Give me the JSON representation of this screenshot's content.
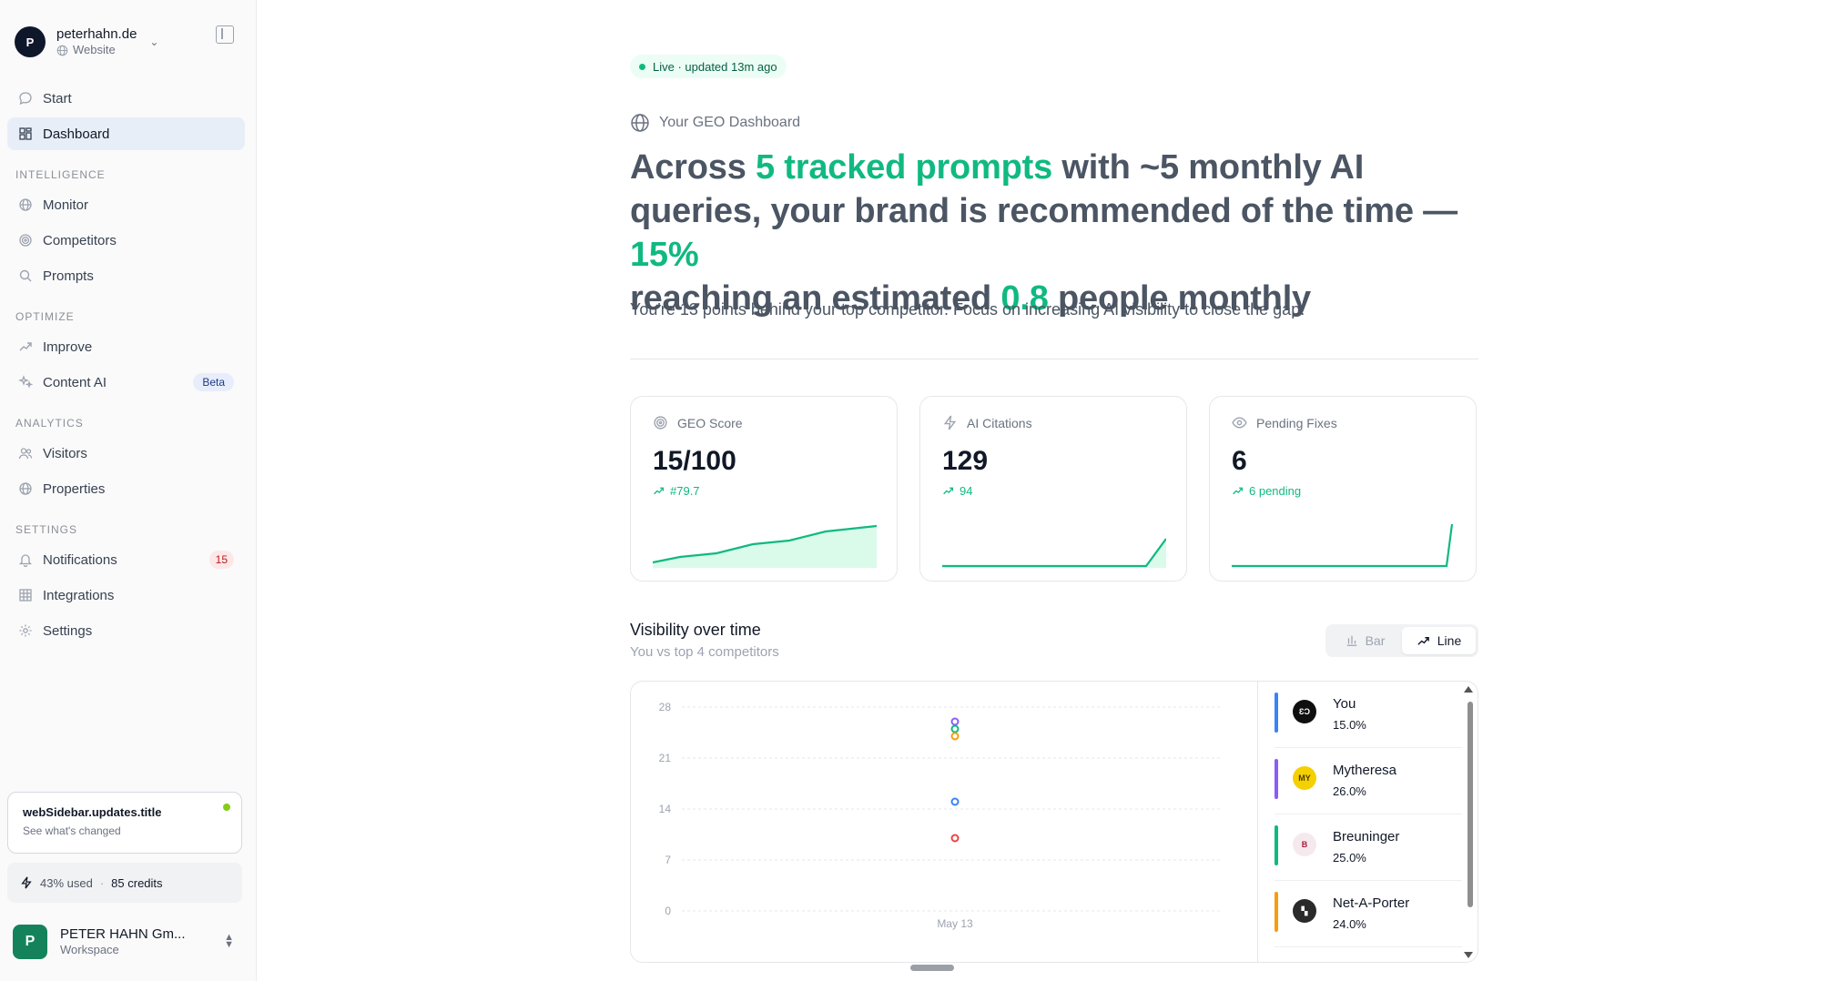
{
  "workspace": {
    "name": "peterhahn.de",
    "type": "Website",
    "avatar_letter": "P"
  },
  "nav": {
    "start": "Start",
    "dashboard": "Dashboard",
    "sections": {
      "intelligence": "INTELLIGENCE",
      "optimize": "OPTIMIZE",
      "analytics": "ANALYTICS",
      "settings": "SETTINGS"
    },
    "monitor": "Monitor",
    "competitors": "Competitors",
    "prompts": "Prompts",
    "improve": "Improve",
    "content_ai": "Content AI",
    "content_ai_badge": "Beta",
    "visitors": "Visitors",
    "properties": "Properties",
    "notifications": "Notifications",
    "notifications_count": "15",
    "integrations": "Integrations",
    "settings": "Settings"
  },
  "updates": {
    "title": "webSidebar.updates.title",
    "subtitle": "See what's changed"
  },
  "credits": {
    "used": "43% used",
    "remaining": "85 credits"
  },
  "org": {
    "name": "PETER HAHN Gm...",
    "sub": "Workspace",
    "avatar_letter": "P"
  },
  "status": {
    "live": "Live · updated 13m ago"
  },
  "dashboard_label": "Your GEO Dashboard",
  "headline": {
    "p1": "Across ",
    "h1": "5 tracked prompts",
    "p2": " with ~5 monthly AI queries, your brand is recommended of the time — ",
    "h2": "15%",
    "p3": " reaching an estimated ",
    "h3": "0.8",
    "p4": " people monthly"
  },
  "subline": "You're 13 points behind your top competitor. Focus on increasing AI visibility to close the gap.",
  "cards": [
    {
      "label": "GEO Score",
      "value": "15/100",
      "trend": "#79.7",
      "icon": "target-icon"
    },
    {
      "label": "AI Citations",
      "value": "129",
      "trend": "94",
      "icon": "lightning-icon"
    },
    {
      "label": "Pending Fixes",
      "value": "6",
      "trend": "6 pending",
      "icon": "eye-icon"
    }
  ],
  "visibility": {
    "title": "Visibility over time",
    "subtitle": "You vs top 4 competitors",
    "toggle_bar": "Bar",
    "toggle_line": "Line",
    "active": "Line"
  },
  "colors": {
    "accent": "#10b981",
    "you": "#3b82f6",
    "mytheresa": "#8b5cf6",
    "breuninger": "#10b981",
    "netaporter": "#f59e0b",
    "extra": "#ef4444"
  },
  "chart_data": {
    "type": "line",
    "x": [
      "May 13"
    ],
    "yticks": [
      0,
      7,
      14,
      21,
      28
    ],
    "ylim": [
      0,
      30
    ],
    "series": [
      {
        "name": "You",
        "values": [
          15
        ]
      },
      {
        "name": "Mytheresa",
        "values": [
          26
        ]
      },
      {
        "name": "Breuninger",
        "values": [
          25
        ]
      },
      {
        "name": "Net-A-Porter",
        "values": [
          24
        ]
      },
      {
        "values": [
          10
        ]
      }
    ]
  },
  "legend": [
    {
      "name": "You",
      "pct": "15.0%",
      "color": "#3b82f6"
    },
    {
      "name": "Mytheresa",
      "pct": "26.0%",
      "color": "#8b5cf6"
    },
    {
      "name": "Breuninger",
      "pct": "25.0%",
      "color": "#10b981"
    },
    {
      "name": "Net-A-Porter",
      "pct": "24.0%",
      "color": "#f59e0b"
    }
  ]
}
